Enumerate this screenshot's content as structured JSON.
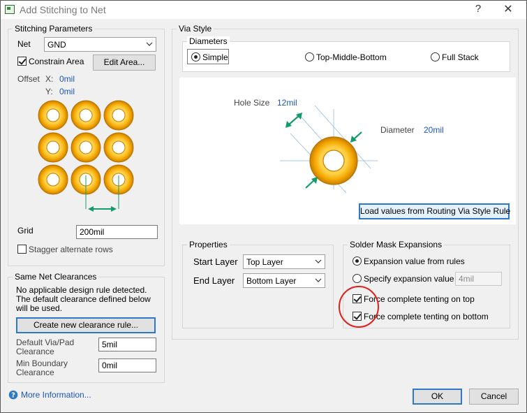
{
  "window": {
    "title": "Add Stitching to Net",
    "help": "?",
    "close": "✕"
  },
  "stitching": {
    "group_label": "Stitching Parameters",
    "net_label": "Net",
    "net_value": "GND",
    "constrain_area_label": "Constrain Area",
    "constrain_area_checked": true,
    "edit_area_button": "Edit Area...",
    "offset_label": "Offset",
    "offset_x_label": "X:",
    "offset_x_value": "0mil",
    "offset_y_label": "Y:",
    "offset_y_value": "0mil",
    "grid_label": "Grid",
    "grid_value": "200mil",
    "stagger_label": "Stagger alternate rows",
    "stagger_checked": false
  },
  "clearances": {
    "group_label": "Same Net Clearances",
    "message": [
      "No applicable design rule detected.",
      "The default clearance defined below",
      "will be used."
    ],
    "create_rule_button": "Create new clearance rule...",
    "default_via_pad_label": [
      "Default Via/Pad",
      "Clearance"
    ],
    "default_via_pad_value": "5mil",
    "min_boundary_label": [
      "Min Boundary",
      "Clearance"
    ],
    "min_boundary_value": "0mil"
  },
  "via_style": {
    "group_label": "Via Style",
    "diameters_label": "Diameters",
    "options": [
      {
        "label": "Simple",
        "checked": true
      },
      {
        "label": "Top-Middle-Bottom",
        "checked": false
      },
      {
        "label": "Full Stack",
        "checked": false
      }
    ],
    "hole_size_label": "Hole Size",
    "hole_size_value": "12mil",
    "diameter_label": "Diameter",
    "diameter_value": "20mil",
    "load_button": "Load values from Routing Via Style Rule"
  },
  "properties": {
    "group_label": "Properties",
    "start_layer_label": "Start Layer",
    "start_layer_value": "Top Layer",
    "end_layer_label": "End Layer",
    "end_layer_value": "Bottom Layer"
  },
  "solder_mask": {
    "group_label": "Solder Mask Expansions",
    "from_rules_label": "Expansion value from rules",
    "from_rules_checked": true,
    "specify_label": "Specify expansion value",
    "specify_checked": false,
    "specify_value": "4mil",
    "tent_top_label": "Force complete tenting on top",
    "tent_top_checked": true,
    "tent_bottom_label": "Force complete tenting on bottom",
    "tent_bottom_checked": true
  },
  "footer": {
    "more_info": "More Information...",
    "ok": "OK",
    "cancel": "Cancel"
  },
  "colors": {
    "via_ring": "#f5a800",
    "via_ring_dark": "#c77e00",
    "arrow_green": "#139b6a",
    "highlight_red": "#e0201a",
    "link_blue": "#1a56b8"
  }
}
